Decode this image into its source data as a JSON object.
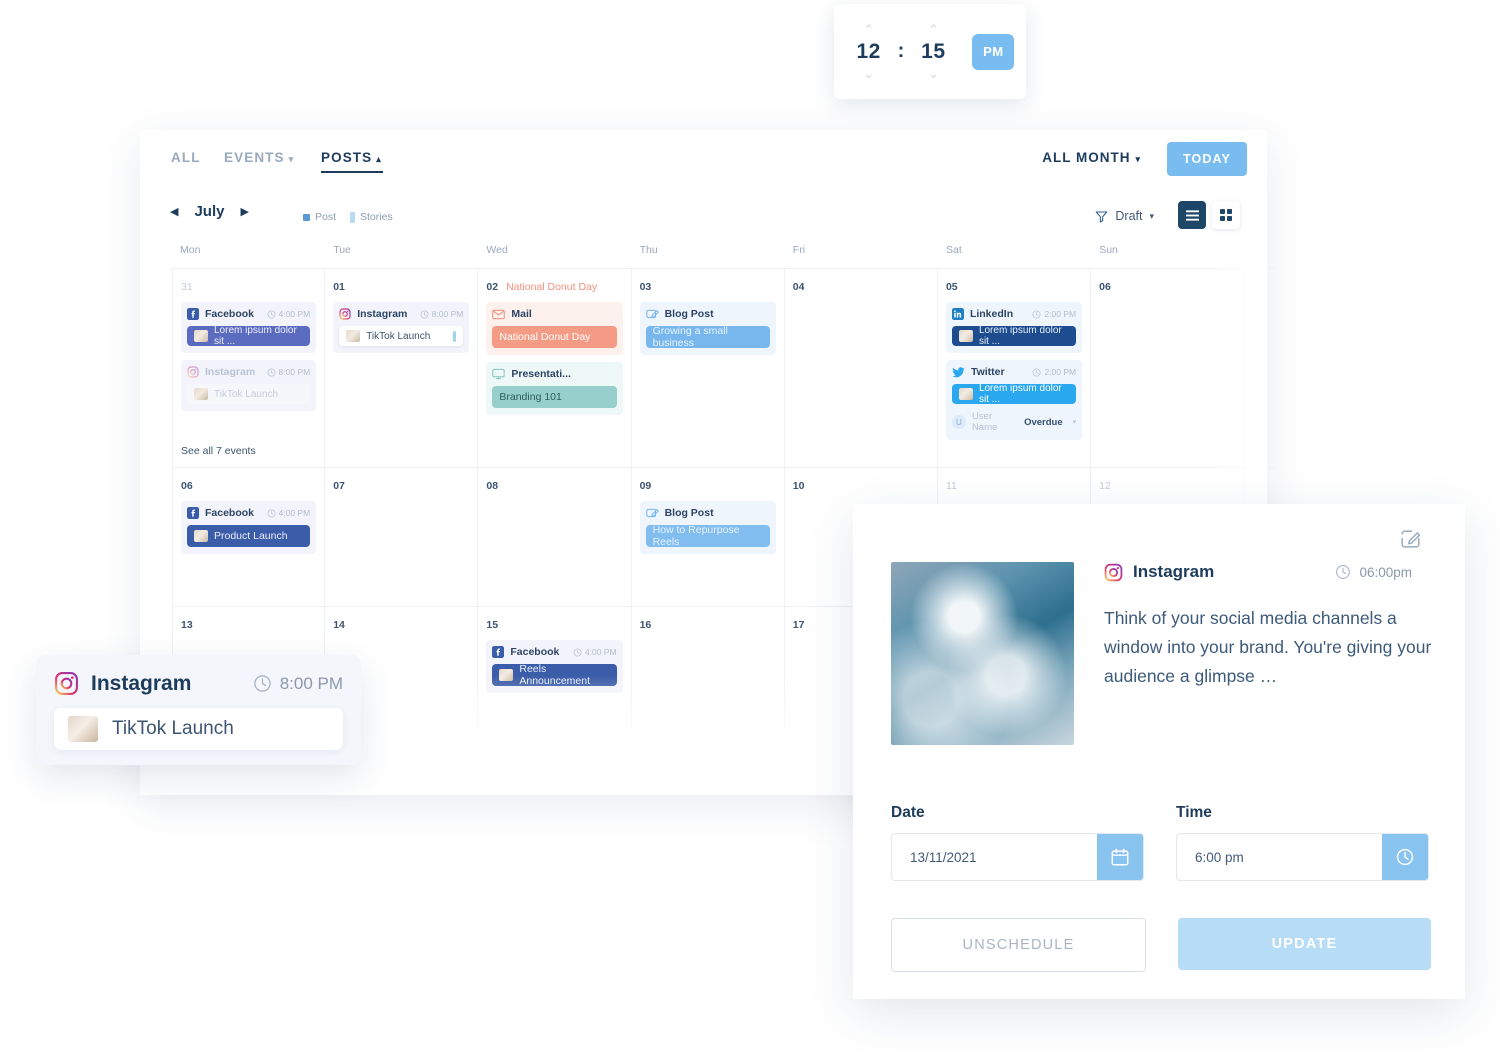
{
  "time_picker": {
    "hour": "12",
    "separator": ":",
    "minute": "15",
    "meridiem": "PM"
  },
  "tabs": [
    {
      "label": "ALL",
      "active": false,
      "caret": ""
    },
    {
      "label": "EVENTS",
      "active": false,
      "caret": "▾"
    },
    {
      "label": "POSTS",
      "active": true,
      "caret": "▴"
    }
  ],
  "header": {
    "all_month_label": "ALL MONTH",
    "all_month_caret": "▾",
    "today_label": "TODAY"
  },
  "toolbar": {
    "prev_arrow": "◀",
    "month": "July",
    "next_arrow": "▶",
    "legend": [
      {
        "label": "Post"
      },
      {
        "label": "Stories"
      }
    ],
    "filter_label": "Draft",
    "filter_caret": "▾"
  },
  "calendar": {
    "day_names": [
      "Mon",
      "Tue",
      "Wed",
      "Thu",
      "Fri",
      "Sat",
      "Sun"
    ],
    "see_all_label": "See all 7 events",
    "weeks": [
      {
        "days": [
          {
            "date": "31",
            "muted": true,
            "day_event": "",
            "events": [
              {
                "platform": "Facebook",
                "icon": "facebook-icon",
                "time": "4:00 PM",
                "box": "lilac",
                "chip": {
                  "text": "Lorem ipsum dolor sit ...",
                  "style": "indigo",
                  "thumb": true
                }
              },
              {
                "platform": "Instagram",
                "icon": "instagram-icon",
                "time": "8:00 PM",
                "box": "lilac",
                "faded": true,
                "chip": {
                  "text": "TikTok Launch",
                  "style": "ghost",
                  "thumb": true
                }
              }
            ],
            "see_all": true
          },
          {
            "date": "01",
            "muted": false,
            "day_event": "",
            "events": [
              {
                "platform": "Instagram",
                "icon": "instagram-icon",
                "time": "8:00 PM",
                "box": "lilac",
                "chip": {
                  "text": "TikTok Launch",
                  "style": "white",
                  "thumb": true,
                  "story_bar": true
                }
              }
            ]
          },
          {
            "date": "02",
            "muted": false,
            "day_event": "National Donut Day",
            "events": [
              {
                "platform": "Mail",
                "icon": "mail-icon",
                "time": "",
                "box": "salmon",
                "chip": {
                  "text": "National Donut Day",
                  "style": "salmon",
                  "thumb": false
                }
              },
              {
                "platform": "Presentati...",
                "icon": "presentation-icon",
                "time": "",
                "box": "teal",
                "chip": {
                  "text": "Branding 101",
                  "style": "teal",
                  "thumb": false
                }
              }
            ]
          },
          {
            "date": "03",
            "muted": false,
            "day_event": "",
            "events": [
              {
                "platform": "Blog Post",
                "icon": "blog-icon",
                "time": "",
                "box": "blue",
                "chip": {
                  "text": "Growing a small business",
                  "style": "softblue",
                  "thumb": false
                }
              }
            ]
          },
          {
            "date": "04",
            "muted": false,
            "day_event": "",
            "events": []
          },
          {
            "date": "05",
            "muted": false,
            "day_event": "",
            "events": [
              {
                "platform": "LinkedIn",
                "icon": "linkedin-icon",
                "time": "2:00 PM",
                "box": "blue",
                "chip": {
                  "text": "Lorem ipsum dolor sit ...",
                  "style": "navy",
                  "thumb": true
                }
              },
              {
                "platform": "Twitter",
                "icon": "twitter-icon",
                "time": "2:00 PM",
                "box": "blue",
                "chip": {
                  "text": "Lorem ipsum dolor sit ...",
                  "style": "lightblue",
                  "thumb": true
                },
                "assignee": {
                  "avatar": "U",
                  "name": "User Name",
                  "status": "Overdue",
                  "caret": "▾"
                }
              }
            ]
          },
          {
            "date": "06",
            "muted": false,
            "day_event": "",
            "events": []
          }
        ]
      },
      {
        "days": [
          {
            "date": "06",
            "muted": false,
            "day_event": "",
            "events": [
              {
                "platform": "Facebook",
                "icon": "facebook-icon",
                "time": "4:00 PM",
                "box": "lilac",
                "chip": {
                  "text": "Product Launch",
                  "style": "fbblue",
                  "thumb": true
                }
              }
            ]
          },
          {
            "date": "07",
            "muted": false,
            "day_event": "",
            "events": []
          },
          {
            "date": "08",
            "muted": false,
            "day_event": "",
            "events": []
          },
          {
            "date": "09",
            "muted": false,
            "day_event": "",
            "events": [
              {
                "platform": "Blog Post",
                "icon": "blog-icon",
                "time": "",
                "box": "blue",
                "chip": {
                  "text": "How to Repurpose Reels",
                  "style": "softblue2",
                  "thumb": false
                }
              }
            ]
          },
          {
            "date": "10",
            "muted": false,
            "day_event": "",
            "events": []
          },
          {
            "date": "11",
            "muted": true,
            "day_event": "",
            "events": []
          },
          {
            "date": "12",
            "muted": true,
            "day_event": "",
            "events": []
          }
        ]
      },
      {
        "days": [
          {
            "date": "13",
            "muted": false,
            "day_event": "",
            "events": []
          },
          {
            "date": "14",
            "muted": false,
            "day_event": "",
            "events": []
          },
          {
            "date": "15",
            "muted": false,
            "day_event": "",
            "events": [
              {
                "platform": "Facebook",
                "icon": "facebook-icon",
                "time": "4:00 PM",
                "box": "lilac",
                "chip": {
                  "text": "Reels Announcement",
                  "style": "fbblue",
                  "thumb": true
                }
              }
            ]
          },
          {
            "date": "16",
            "muted": false,
            "day_event": "",
            "events": []
          },
          {
            "date": "17",
            "muted": false,
            "day_event": "",
            "events": []
          },
          {
            "date": "",
            "muted": true,
            "day_event": "",
            "events": []
          },
          {
            "date": "",
            "muted": true,
            "day_event": "",
            "events": []
          }
        ]
      }
    ]
  },
  "floating_card": {
    "platform": "Instagram",
    "time": "8:00 PM",
    "post_title": "TikTok Launch"
  },
  "detail_panel": {
    "platform": "Instagram",
    "time": "06:00pm",
    "caption": "Think of your social media channels a window into your brand. You're giving your audience a glimpse …",
    "date_label": "Date",
    "date_value": "13/11/2021",
    "time_label": "Time",
    "time_value": "6:00 pm",
    "unschedule_label": "UNSCHEDULE",
    "update_label": "UPDATE"
  },
  "colors": {
    "accent_blue": "#79bdf0",
    "navy": "#1d3c5c",
    "salmon": "#f49b85",
    "teal": "#96cfcb",
    "indigo": "#5b6bc0",
    "facebook_blue": "#3b5ca8"
  }
}
